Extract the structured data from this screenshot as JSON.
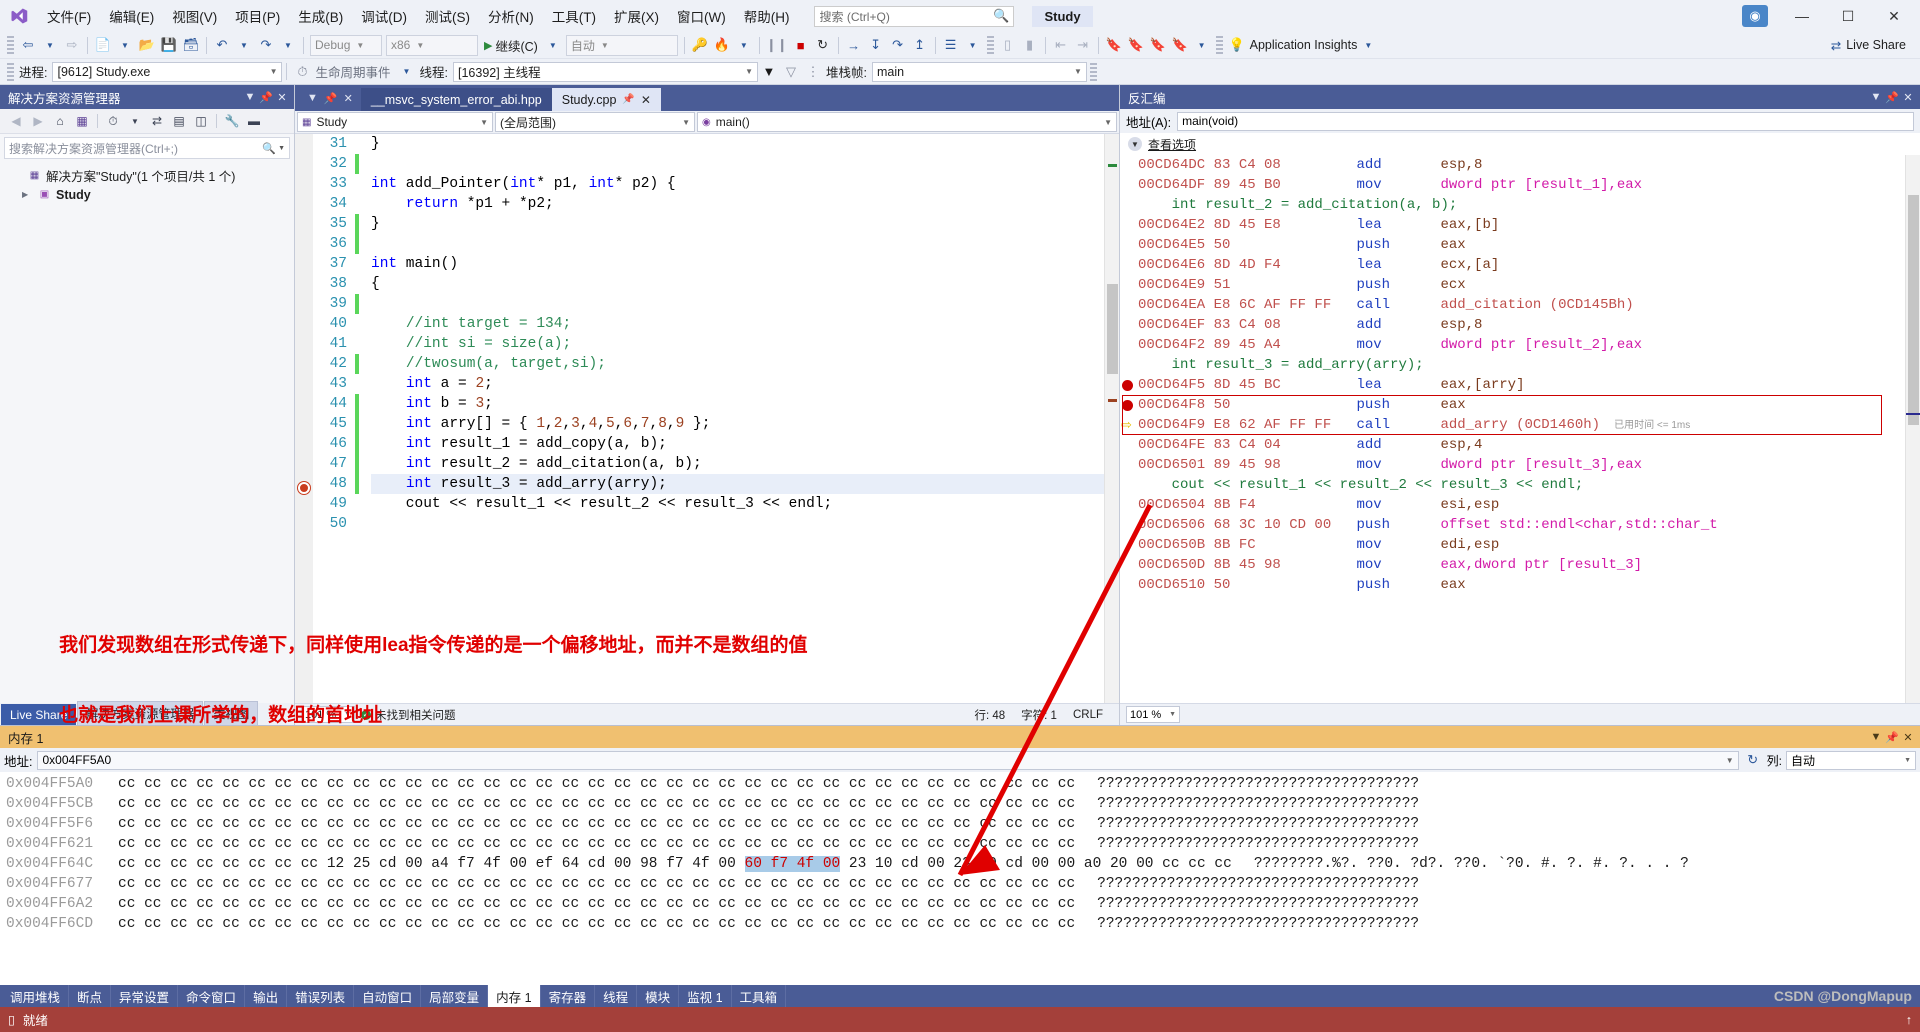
{
  "titlebar": {
    "menus": [
      "文件(F)",
      "编辑(E)",
      "视图(V)",
      "项目(P)",
      "生成(B)",
      "调试(D)",
      "测试(S)",
      "分析(N)",
      "工具(T)",
      "扩展(X)",
      "窗口(W)",
      "帮助(H)"
    ],
    "search_placeholder": "搜索 (Ctrl+Q)",
    "project_chip": "Study",
    "minimize": "—",
    "maximize": "☐",
    "close": "✕"
  },
  "toolbar": {
    "config": "Debug",
    "platform": "x86",
    "continue_label": "继续(C)",
    "auto_label": "自动",
    "app_insights": "Application Insights",
    "live_share": "Live Share"
  },
  "debugbar": {
    "process_label": "进程:",
    "process_value": "[9612] Study.exe",
    "lifecycle_label": "生命周期事件",
    "thread_label": "线程:",
    "thread_value": "[16392] 主线程",
    "stack_label": "堆栈帧:",
    "stack_value": "main"
  },
  "solution": {
    "title": "解决方案资源管理器",
    "search_placeholder": "搜索解决方案资源管理器(Ctrl+;)",
    "root": "解决方案\"Study\"(1 个项目/共 1 个)",
    "project": "Study",
    "tabs": [
      "Live Share",
      "解决方案资源管理器",
      "类视图"
    ]
  },
  "editor": {
    "tabs": [
      {
        "label": "__msvc_system_error_abi.hpp",
        "active": false
      },
      {
        "label": "Study.cpp",
        "active": true
      }
    ],
    "nav": {
      "project": "Study",
      "scope": "(全局范围)",
      "member": "main()"
    },
    "lines": [
      {
        "n": 31,
        "changed": false
      },
      {
        "n": 32,
        "changed": true
      },
      {
        "n": 33,
        "changed": false
      },
      {
        "n": 34,
        "changed": false
      },
      {
        "n": 35,
        "changed": true
      },
      {
        "n": 36,
        "changed": true
      },
      {
        "n": 37,
        "changed": false
      },
      {
        "n": 38,
        "changed": false
      },
      {
        "n": 39,
        "changed": true
      },
      {
        "n": 40,
        "changed": false
      },
      {
        "n": 41,
        "changed": false
      },
      {
        "n": 42,
        "changed": true
      },
      {
        "n": 43,
        "changed": false
      },
      {
        "n": 44,
        "changed": true
      },
      {
        "n": 45,
        "changed": true
      },
      {
        "n": 46,
        "changed": true
      },
      {
        "n": 47,
        "changed": true
      },
      {
        "n": 48,
        "changed": true
      },
      {
        "n": 49,
        "changed": false
      },
      {
        "n": 50,
        "changed": false
      }
    ],
    "footer": {
      "zoom": "101 %",
      "issues": "未找到相关问题",
      "line": "行: 48",
      "col": "字符: 1",
      "eol": "CRLF"
    }
  },
  "disasm": {
    "title": "反汇编",
    "addr_label": "地址(A):",
    "addr_value": "main(void)",
    "view_options": "查看选项",
    "elapsed": "已用时间 <= 1ms",
    "zoom": "101 %",
    "rows": [
      {
        "kind": "asm",
        "addr": "00CD64DC",
        "bytes": "83 C4 08",
        "mn": "add",
        "op": "esp,8",
        "opnum": "8"
      },
      {
        "kind": "asm",
        "addr": "00CD64DF",
        "bytes": "89 45 B0",
        "mn": "mov",
        "op": "dword ptr [result_1],eax",
        "ptr": true
      },
      {
        "kind": "src",
        "text": "    int result_2 = add_citation(a, b);"
      },
      {
        "kind": "asm",
        "addr": "00CD64E2",
        "bytes": "8D 45 E8",
        "mn": "lea",
        "op": "eax,[b]"
      },
      {
        "kind": "asm",
        "addr": "00CD64E5",
        "bytes": "50",
        "mn": "push",
        "op": "eax"
      },
      {
        "kind": "asm",
        "addr": "00CD64E6",
        "bytes": "8D 4D F4",
        "mn": "lea",
        "op": "ecx,[a]"
      },
      {
        "kind": "asm",
        "addr": "00CD64E9",
        "bytes": "51",
        "mn": "push",
        "op": "ecx"
      },
      {
        "kind": "asm",
        "addr": "00CD64EA",
        "bytes": "E8 6C AF FF FF",
        "mn": "call",
        "op": "add_citation (0CD145Bh)",
        "sym": true
      },
      {
        "kind": "asm",
        "addr": "00CD64EF",
        "bytes": "83 C4 08",
        "mn": "add",
        "op": "esp,8"
      },
      {
        "kind": "asm",
        "addr": "00CD64F2",
        "bytes": "89 45 A4",
        "mn": "mov",
        "op": "dword ptr [result_2],eax",
        "ptr": true
      },
      {
        "kind": "src",
        "text": "    int result_3 = add_arry(arry);"
      },
      {
        "kind": "asm",
        "addr": "00CD64F5",
        "bytes": "8D 45 BC",
        "mn": "lea",
        "op": "eax,[arry]",
        "bp": true
      },
      {
        "kind": "asm",
        "addr": "00CD64F8",
        "bytes": "50",
        "mn": "push",
        "op": "eax",
        "bp": true
      },
      {
        "kind": "asm",
        "addr": "00CD64F9",
        "bytes": "E8 62 AF FF FF",
        "mn": "call",
        "op": "add_arry (0CD1460h)",
        "sym": true,
        "cur": true
      },
      {
        "kind": "asm",
        "addr": "00CD64FE",
        "bytes": "83 C4 04",
        "mn": "add",
        "op": "esp,4"
      },
      {
        "kind": "asm",
        "addr": "00CD6501",
        "bytes": "89 45 98",
        "mn": "mov",
        "op": "dword ptr [result_3],eax",
        "ptr": true
      },
      {
        "kind": "src",
        "text": "    cout << result_1 << result_2 << result_3 << endl;"
      },
      {
        "kind": "asm",
        "addr": "00CD6504",
        "bytes": "8B F4",
        "mn": "mov",
        "op": "esi,esp"
      },
      {
        "kind": "asm",
        "addr": "00CD6506",
        "bytes": "68 3C 10 CD 00",
        "mn": "push",
        "op": "offset std::endl<char,std::char_t",
        "ptr": true
      },
      {
        "kind": "asm",
        "addr": "00CD650B",
        "bytes": "8B FC",
        "mn": "mov",
        "op": "edi,esp"
      },
      {
        "kind": "asm",
        "addr": "00CD650D",
        "bytes": "8B 45 98",
        "mn": "mov",
        "op": "eax,dword ptr [result_3]",
        "ptr": true
      },
      {
        "kind": "asm",
        "addr": "00CD6510",
        "bytes": "50",
        "mn": "push",
        "op": "eax"
      }
    ]
  },
  "memory": {
    "title": "内存 1",
    "addr_label": "地址:",
    "addr_value": "0x004FF5A0",
    "col_label": "列:",
    "col_value": "自动",
    "rows": [
      {
        "addr": "0x004FF5A0",
        "hex": "cc cc cc cc cc cc cc cc cc cc cc cc cc cc cc cc cc cc cc cc cc cc cc cc cc cc cc cc cc cc cc cc cc cc cc cc cc",
        "ascii": "?????????????????????????????????????"
      },
      {
        "addr": "0x004FF5CB",
        "hex": "cc cc cc cc cc cc cc cc cc cc cc cc cc cc cc cc cc cc cc cc cc cc cc cc cc cc cc cc cc cc cc cc cc cc cc cc cc",
        "ascii": "?????????????????????????????????????"
      },
      {
        "addr": "0x004FF5F6",
        "hex": "cc cc cc cc cc cc cc cc cc cc cc cc cc cc cc cc cc cc cc cc cc cc cc cc cc cc cc cc cc cc cc cc cc cc cc cc cc",
        "ascii": "?????????????????????????????????????"
      },
      {
        "addr": "0x004FF621",
        "hex": "cc cc cc cc cc cc cc cc cc cc cc cc cc cc cc cc cc cc cc cc cc cc cc cc cc cc cc cc cc cc cc cc cc cc cc cc cc",
        "ascii": "?????????????????????????????????????"
      },
      {
        "addr": "0x004FF64C",
        "selected": true,
        "hex_pre": "cc cc cc cc cc cc cc cc 12 25 cd 00 a4 f7 4f 00 ef 64 cd 00 98 f7 4f 00 ",
        "hex_sel": "60 f7 4f 00",
        "hex_post": " 23 10 cd 00 23 10 cd 00 00 a0 20 00 cc cc cc",
        "ascii": "????????.%?. ??0. ?d?. ??0. `?0. #. ?. #. ?. . . ?"
      },
      {
        "addr": "0x004FF677",
        "hex": "cc cc cc cc cc cc cc cc cc cc cc cc cc cc cc cc cc cc cc cc cc cc cc cc cc cc cc cc cc cc cc cc cc cc cc cc cc",
        "ascii": "?????????????????????????????????????"
      },
      {
        "addr": "0x004FF6A2",
        "hex": "cc cc cc cc cc cc cc cc cc cc cc cc cc cc cc cc cc cc cc cc cc cc cc cc cc cc cc cc cc cc cc cc cc cc cc cc cc",
        "ascii": "?????????????????????????????????????"
      },
      {
        "addr": "0x004FF6CD",
        "hex": "cc cc cc cc cc cc cc cc cc cc cc cc cc cc cc cc cc cc cc cc cc cc cc cc cc cc cc cc cc cc cc cc cc cc cc cc cc",
        "ascii": "?????????????????????????????????????"
      }
    ]
  },
  "bottom_tabs": [
    {
      "label": "调用堆栈",
      "active": false
    },
    {
      "label": "断点",
      "active": false
    },
    {
      "label": "异常设置",
      "active": false
    },
    {
      "label": "命令窗口",
      "active": false
    },
    {
      "label": "输出",
      "active": false
    },
    {
      "label": "错误列表",
      "active": false
    },
    {
      "label": "自动窗口",
      "active": false
    },
    {
      "label": "局部变量",
      "active": false
    },
    {
      "label": "内存 1",
      "active": true
    },
    {
      "label": "寄存器",
      "active": false
    },
    {
      "label": "线程",
      "active": false
    },
    {
      "label": "模块",
      "active": false
    },
    {
      "label": "监视 1",
      "active": false
    },
    {
      "label": "工具箱",
      "active": false
    }
  ],
  "status": {
    "text": "就绪",
    "notify": "↑"
  },
  "annotation": {
    "line1": "我们发现数组在形式传递下，同样使用lea指令传递的是一个偏移地址，而并不是数组的值",
    "line2": "也就是我们上课所学的，数组的首地址",
    "color": "#e00000"
  },
  "watermark": "CSDN @DongMapup"
}
